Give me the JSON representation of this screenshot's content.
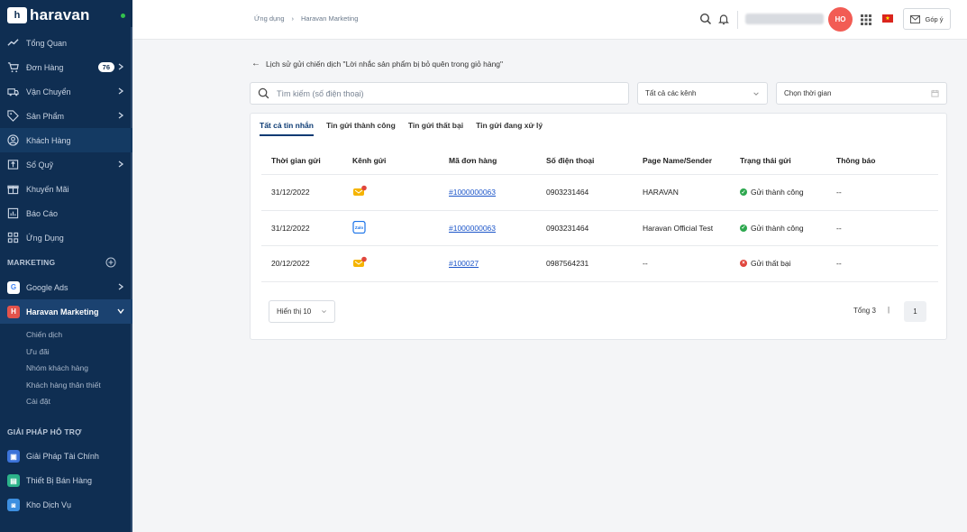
{
  "sidebar": {
    "logo_mark": "h",
    "logo_text": "haravan",
    "nav": [
      {
        "label": "Tổng Quan",
        "icon": "chart-line-icon"
      },
      {
        "label": "Đơn Hàng",
        "icon": "cart-icon",
        "badge": "76"
      },
      {
        "label": "Vận Chuyển",
        "icon": "truck-icon"
      },
      {
        "label": "Sản Phẩm",
        "icon": "tag-icon"
      },
      {
        "label": "Khách Hàng",
        "icon": "user-icon"
      },
      {
        "label": "Sổ Quỹ",
        "icon": "cash-box-icon"
      },
      {
        "label": "Khuyến Mãi",
        "icon": "gift-icon"
      },
      {
        "label": "Báo Cáo",
        "icon": "report-icon"
      },
      {
        "label": "Ứng Dụng",
        "icon": "apps-icon"
      }
    ],
    "marketing_title": "MARKETING",
    "marketing_items": [
      {
        "label": "Google Ads",
        "icon_text": "G"
      },
      {
        "label": "Haravan Marketing",
        "icon_text": "H"
      }
    ],
    "sub_items": [
      "Chiến dịch",
      "Ưu đãi",
      "Nhóm khách hàng",
      "Khách hàng thân thiết",
      "Cài đặt"
    ],
    "support_title": "GIẢI PHÁP HỖ TRỢ",
    "support_items": [
      {
        "label": "Giải Pháp Tài Chính",
        "color": "#3b73d9"
      },
      {
        "label": "Thiết Bị Bán Hàng",
        "color": "#2bb38a"
      },
      {
        "label": "Kho Dịch Vụ",
        "color": "#3d8fe0"
      }
    ]
  },
  "topbar": {
    "breadcrumb": [
      "Ứng dụng",
      "Haravan Marketing"
    ],
    "avatar": "HO",
    "flag_star": "★",
    "feedback": "Góp ý"
  },
  "main": {
    "back_text": "Lịch sử gửi chiến dịch \"Lời nhắc sản phẩm bị bỏ quên trong giỏ hàng\"",
    "search_placeholder": "Tìm kiếm (số điện thoại)",
    "channel_select": "Tất cả các kênh",
    "date_placeholder": "Chọn thời gian",
    "tabs": [
      "Tất cả tin nhắn",
      "Tin gửi thành công",
      "Tin gửi thất bại",
      "Tin gửi đang xử lý"
    ],
    "columns": [
      "Thời gian gửi",
      "Kênh gửi",
      "Mã đơn hàng",
      "Số điện thoại",
      "Page Name/Sender",
      "Trạng thái gửi",
      "Thông báo"
    ],
    "rows": [
      {
        "time": "31/12/2022",
        "channel": "messenger",
        "order": "#1000000063",
        "phone": "0903231464",
        "sender": "HARAVAN",
        "status": "Gửi thành công",
        "status_ok": true,
        "note": "--"
      },
      {
        "time": "31/12/2022",
        "channel": "zalo",
        "order": "#1000000063",
        "phone": "0903231464",
        "sender": "Haravan Official Test",
        "status": "Gửi thành công",
        "status_ok": true,
        "note": "--"
      },
      {
        "time": "20/12/2022",
        "channel": "messenger",
        "order": "#100027",
        "phone": "0987564231",
        "sender": "--",
        "status": "Gửi thất bại",
        "status_ok": false,
        "note": "--"
      }
    ],
    "page_size": "Hiển thị 10",
    "total": "Tổng 3",
    "pager_sep": "|",
    "current_page": "1",
    "zalo_label": "Zalo"
  },
  "colors": {
    "sidebar": "#0f2e52",
    "accent": "#0b3a73",
    "link": "#1d56c9",
    "success": "#2ea84f",
    "error": "#e0463d",
    "avatar": "#f25c54"
  }
}
